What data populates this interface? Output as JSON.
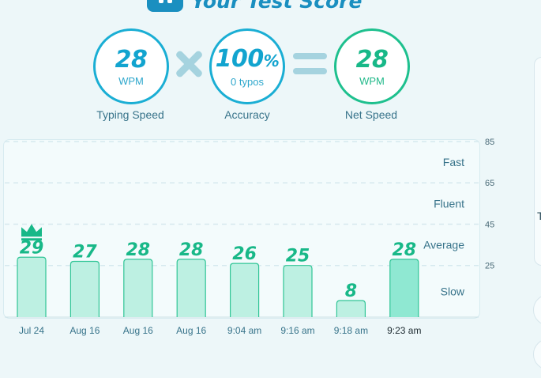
{
  "header": {
    "title": "Your Test Score",
    "icon": "keyboard-icon"
  },
  "stats": {
    "typing_speed": {
      "value": "28",
      "unit": "WPM",
      "caption": "Typing Speed"
    },
    "accuracy": {
      "value": "100",
      "percent": "%",
      "sub": "0 typos",
      "caption": "Accuracy"
    },
    "net_speed": {
      "value": "28",
      "unit": "WPM",
      "caption": "Net Speed"
    }
  },
  "colors": {
    "blue": "#12a4cf",
    "green": "#18b888",
    "bar_fill": "#bdf0e2",
    "bar_fill_latest": "#8fe8d2",
    "bar_stroke": "#30c596"
  },
  "chart_data": {
    "type": "bar",
    "categories": [
      "Jul 24",
      "Aug 16",
      "Aug 16",
      "Aug 16",
      "9:04 am",
      "9:16 am",
      "9:18 am",
      "9:23 am"
    ],
    "values": [
      29,
      27,
      28,
      28,
      26,
      25,
      8,
      28
    ],
    "ylim": [
      0,
      85
    ],
    "yticks": [
      85,
      65,
      45,
      25
    ],
    "zones": [
      {
        "label": "Fast",
        "from": 65,
        "to": 85
      },
      {
        "label": "Fluent",
        "from": 45,
        "to": 65
      },
      {
        "label": "Average",
        "from": 25,
        "to": 45
      },
      {
        "label": "Slow",
        "from": 0,
        "to": 25
      }
    ],
    "best_index": 0,
    "best_icon": "crown-icon",
    "latest_index": 7,
    "grid": true
  },
  "side": {
    "panel_text": "T"
  }
}
